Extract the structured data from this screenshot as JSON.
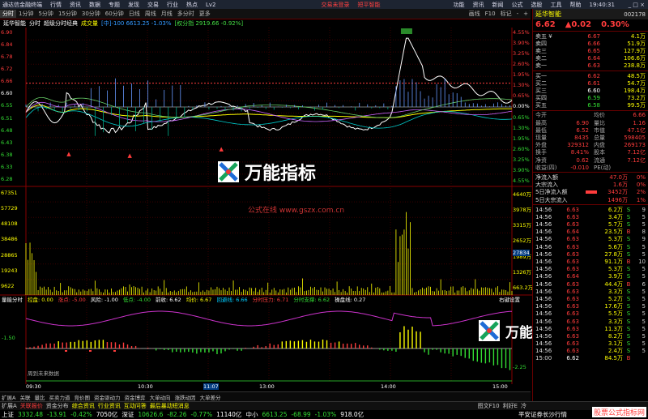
{
  "titlebar": {
    "app": "通达信金融终端",
    "menus": [
      "行情",
      "资讯",
      "数据",
      "专题",
      "发现",
      "交易",
      "行业",
      "热点",
      "Lv2"
    ],
    "login": "交易未登录",
    "smart": "短平智能",
    "right_menus": [
      "功能",
      "资讯",
      "新闻",
      "公式",
      "选股",
      "工具",
      "帮助"
    ],
    "clock": "19:40:31"
  },
  "toolbar": {
    "tabs": [
      "分时",
      "1分钟",
      "5分钟",
      "15分钟",
      "30分钟",
      "60分钟",
      "日线",
      "周线",
      "月线",
      "多分时",
      "更多"
    ],
    "selected": 0,
    "right": [
      "画线",
      "F10",
      "标记",
      "-",
      "+"
    ]
  },
  "chartbar": {
    "name": "延华智能",
    "mode": "分时",
    "indicator": "超级分时经典",
    "vol": "成交量",
    "info1": "[中]-100 6613.25 -1.03%",
    "info2": "[权分指 2919.66 -0.92%]"
  },
  "price_axis": {
    "left": [
      "6.90",
      "6.84",
      "6.78",
      "6.72",
      "6.66",
      "6.60",
      "6.55",
      "6.51",
      "6.48",
      "6.43",
      "6.38",
      "6.33",
      "6.28"
    ],
    "right": [
      "4.55%",
      "3.90%",
      "3.25%",
      "2.60%",
      "1.95%",
      "1.30%",
      "0.65%",
      "0.00%",
      "0.65%",
      "1.30%",
      "1.95%",
      "2.60%",
      "3.25%",
      "3.90%",
      "4.55%"
    ]
  },
  "volume_axis": {
    "left": [
      "67351",
      "57729",
      "48108",
      "38486",
      "28865",
      "19243",
      "9622"
    ],
    "right": [
      "4640万",
      "3978万",
      "3315万",
      "2652万",
      "1989万",
      "1326万",
      "663.2万"
    ],
    "highlight": "27834"
  },
  "subbar": {
    "name": "量能分时",
    "items": [
      "控盘: 0.00",
      "涨点: -5.00",
      "风险: -1.00",
      "低点: -4.00",
      "前收: 6.62",
      "均价: 6.67",
      "回避线: 6.66",
      "分时压力: 6.71",
      "分时支撑: 6.62",
      "操盘线: 0.27"
    ],
    "right": "右键设置"
  },
  "sub_axis": {
    "left": [
      "-1.50"
    ],
    "right": [
      "-2.25"
    ]
  },
  "sub_note": "周到未来数据",
  "time_axis": [
    "09:30",
    "10:30",
    "11:07",
    "13:00",
    "14:00",
    "15:00"
  ],
  "bottom_tabs": [
    "扩展A",
    "关联",
    "量比",
    "买卖力道",
    "竞价图",
    "资金驱动力",
    "资金博弈",
    "大单动向",
    "涨跌动因",
    "大单差分"
  ],
  "bottom_tabs2": [
    "扩展A",
    "关联报价",
    "资金分布",
    "综合资讯",
    "行业资讯",
    "互动问答",
    "最后暴动短消息"
  ],
  "stock": {
    "name": "延华智能",
    "code": "002178",
    "price": "6.62",
    "change": "0.02",
    "pct": "0.30%"
  },
  "order_book": {
    "asks": [
      {
        "label": "卖五 ¥",
        "price": "6.67",
        "vol": "4.1万"
      },
      {
        "label": "卖四",
        "price": "6.66",
        "vol": "51.9万"
      },
      {
        "label": "卖三",
        "price": "6.65",
        "vol": "127.9万"
      },
      {
        "label": "卖二",
        "price": "6.64",
        "vol": "106.6万"
      },
      {
        "label": "卖一",
        "price": "6.63",
        "vol": "238.8万"
      }
    ],
    "bids": [
      {
        "label": "买一",
        "price": "6.62",
        "vol": "48.5万"
      },
      {
        "label": "买二",
        "price": "6.61",
        "vol": "54.7万"
      },
      {
        "label": "买三",
        "price": "6.60",
        "vol": "198.4万"
      },
      {
        "label": "买四",
        "price": "6.59",
        "vol": "73.2万"
      },
      {
        "label": "买五",
        "price": "6.58",
        "vol": "99.5万"
      }
    ]
  },
  "stats": [
    {
      "k1": "今开",
      "v1": "",
      "k2": "均价",
      "v2": "6.66"
    },
    {
      "k1": "最高",
      "v1": "6.90",
      "k2": "量比",
      "v2": "1.16"
    },
    {
      "k1": "最低",
      "v1": "6.52",
      "k2": "市值",
      "v2": "47.1亿"
    },
    {
      "k1": "现量",
      "v1": "8435",
      "k2": "总量",
      "v2": "598405"
    },
    {
      "k1": "外盘",
      "v1": "329312",
      "k2": "内盘",
      "v2": "269173"
    },
    {
      "k1": "换手",
      "v1": "8.41%",
      "k2": "股本",
      "v2": "7.12亿"
    },
    {
      "k1": "净资",
      "v1": "0.62",
      "k2": "流通",
      "v2": "7.12亿"
    },
    {
      "k1": "收益(四)",
      "v1": "-0.010",
      "k2": "PE(动)",
      "v2": ""
    }
  ],
  "flows": [
    {
      "label": "净流入额",
      "val": "47.0万",
      "pct": "0%"
    },
    {
      "label": "大宗流入",
      "val": "1.6万",
      "pct": "0%"
    },
    {
      "label": "5日净流入额",
      "val": "3452万",
      "pct": "2%"
    },
    {
      "label": "5日大宗流入",
      "val": "1496万",
      "pct": "1%"
    }
  ],
  "ticks": [
    {
      "t": "14:56",
      "p": "6.63",
      "v": "6.2万",
      "s": "S",
      "n": "9"
    },
    {
      "t": "14:56",
      "p": "6.63",
      "v": "3.4万",
      "s": "S",
      "n": "5"
    },
    {
      "t": "14:56",
      "p": "6.63",
      "v": "5.7万",
      "s": "S",
      "n": "5"
    },
    {
      "t": "14:56",
      "p": "6.64",
      "v": "23.5万",
      "s": "B",
      "n": "8"
    },
    {
      "t": "14:56",
      "p": "6.63",
      "v": "5.3万",
      "s": "S",
      "n": "9"
    },
    {
      "t": "14:56",
      "p": "6.63",
      "v": "5.6万",
      "s": "S",
      "n": "5"
    },
    {
      "t": "14:56",
      "p": "6.63",
      "v": "27.8万",
      "s": "S",
      "n": "5"
    },
    {
      "t": "14:56",
      "p": "6.63",
      "v": "91.1万",
      "s": "B",
      "n": "10"
    },
    {
      "t": "14:56",
      "p": "6.63",
      "v": "5.3万",
      "s": "S",
      "n": "5"
    },
    {
      "t": "14:56",
      "p": "6.64",
      "v": "3.9万",
      "s": "S",
      "n": "5"
    },
    {
      "t": "14:56",
      "p": "6.63",
      "v": "44.4万",
      "s": "B",
      "n": "6"
    },
    {
      "t": "14:56",
      "p": "6.63",
      "v": "3.3万",
      "s": "S",
      "n": "5"
    },
    {
      "t": "14:56",
      "p": "6.63",
      "v": "5.2万",
      "s": "S",
      "n": "5"
    },
    {
      "t": "14:56",
      "p": "6.63",
      "v": "17.6万",
      "s": "S",
      "n": "5"
    },
    {
      "t": "14:56",
      "p": "6.63",
      "v": "5.5万",
      "s": "S",
      "n": "5"
    },
    {
      "t": "14:56",
      "p": "6.63",
      "v": "3.3万",
      "s": "S",
      "n": "5"
    },
    {
      "t": "14:56",
      "p": "6.63",
      "v": "11.3万",
      "s": "S",
      "n": "5"
    },
    {
      "t": "14:56",
      "p": "6.63",
      "v": "8.2万",
      "s": "S",
      "n": "5"
    },
    {
      "t": "14:56",
      "p": "6.63",
      "v": "3.1万",
      "s": "S",
      "n": "5"
    },
    {
      "t": "14:56",
      "p": "6.63",
      "v": "2.4万",
      "s": "S",
      "n": "5"
    },
    {
      "t": "15:00",
      "p": "6.62",
      "v": "84.5万",
      "s": "B",
      "n": ""
    }
  ],
  "indices": [
    {
      "name": "上证",
      "val": "3332.48",
      "chg": "-13.91",
      "pct": "-0.42%",
      "amt": "7050亿"
    },
    {
      "name": "深证",
      "val": "10626.6",
      "chg": "-82.26",
      "pct": "-0.77%",
      "amt": "11140亿"
    },
    {
      "name": "中小",
      "val": "6613.25",
      "chg": "-68.99",
      "pct": "-1.03%",
      "amt": "918.0亿"
    }
  ],
  "status_right": "平安证券长沙行情",
  "status_tabs": [
    "图文F10",
    "利好E",
    "冷"
  ],
  "watermark": {
    "brand": "万能指标",
    "site": "公式在线 www.gszx.com.cn"
  },
  "corner_wm": "股票公式指标网",
  "colors": {
    "up": "#ff3c3c",
    "down": "#33dd33",
    "accent": "#ffff00",
    "price_line": "#ffffff",
    "avg_line": "#ffff00"
  }
}
